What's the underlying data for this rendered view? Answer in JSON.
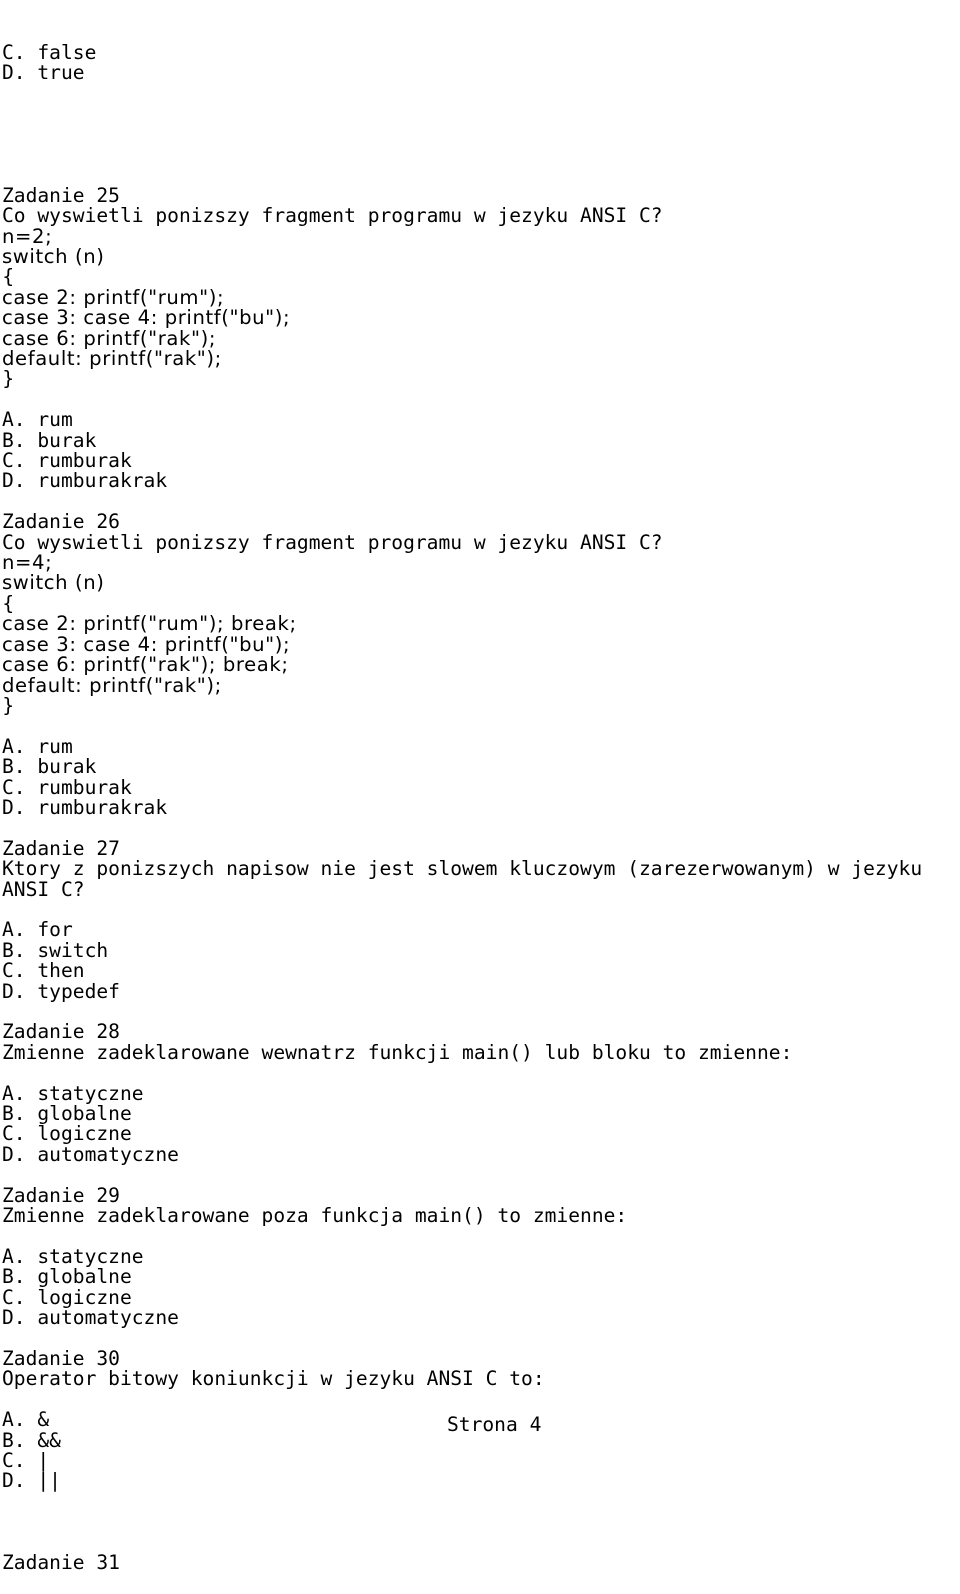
{
  "leading_options": [
    {
      "letter": "C.",
      "text": "false"
    },
    {
      "letter": "D.",
      "text": "true"
    }
  ],
  "tasks": [
    {
      "title": "Zadanie 25",
      "question": [
        "Co wyswietli ponizszy fragment programu w jezyku ANSI C?"
      ],
      "code": [
        "n=2;",
        "switch (n)",
        "{",
        "case 2: printf(\"rum\");",
        "case 3: case 4: printf(\"bu\");",
        "case 6: printf(\"rak\");",
        "default: printf(\"rak\");",
        "}"
      ],
      "options": [
        {
          "letter": "A.",
          "text": "rum"
        },
        {
          "letter": "B.",
          "text": "burak"
        },
        {
          "letter": "C.",
          "text": "rumburak"
        },
        {
          "letter": "D.",
          "text": "rumburakrak"
        }
      ]
    },
    {
      "title": "Zadanie 26",
      "question": [
        "Co wyswietli ponizszy fragment programu w jezyku ANSI C?"
      ],
      "code": [
        "n=4;",
        "switch (n)",
        "{",
        "case 2: printf(\"rum\"); break;",
        "case 3: case 4: printf(\"bu\");",
        "case 6: printf(\"rak\"); break;",
        "default: printf(\"rak\");",
        "}"
      ],
      "options": [
        {
          "letter": "A.",
          "text": "rum"
        },
        {
          "letter": "B.",
          "text": "burak"
        },
        {
          "letter": "C.",
          "text": "rumburak"
        },
        {
          "letter": "D.",
          "text": "rumburakrak"
        }
      ]
    },
    {
      "title": "Zadanie 27",
      "question": [
        "Ktory z ponizszych napisow nie jest slowem kluczowym (zarezerwowanym) w jezyku",
        "ANSI C?"
      ],
      "code": [],
      "options": [
        {
          "letter": "A.",
          "text": "for"
        },
        {
          "letter": "B.",
          "text": "switch"
        },
        {
          "letter": "C.",
          "text": "then"
        },
        {
          "letter": "D.",
          "text": "typedef"
        }
      ]
    },
    {
      "title": "Zadanie 28",
      "question": [
        "Zmienne zadeklarowane wewnatrz funkcji main() lub bloku to zmienne:"
      ],
      "code": [],
      "options": [
        {
          "letter": "A.",
          "text": "statyczne"
        },
        {
          "letter": "B.",
          "text": "globalne"
        },
        {
          "letter": "C.",
          "text": "logiczne"
        },
        {
          "letter": "D.",
          "text": "automatyczne"
        }
      ]
    },
    {
      "title": "Zadanie 29",
      "question": [
        "Zmienne zadeklarowane poza funkcja main() to zmienne:"
      ],
      "code": [],
      "options": [
        {
          "letter": "A.",
          "text": "statyczne"
        },
        {
          "letter": "B.",
          "text": "globalne"
        },
        {
          "letter": "C.",
          "text": "logiczne"
        },
        {
          "letter": "D.",
          "text": "automatyczne"
        }
      ]
    },
    {
      "title": "Zadanie 30",
      "question": [
        "Operator bitowy koniunkcji w jezyku ANSI C to:"
      ],
      "code": [],
      "options": [
        {
          "letter": "A.",
          "text": "&"
        },
        {
          "letter": "B.",
          "text": "&&"
        },
        {
          "letter": "C.",
          "text": "|"
        },
        {
          "letter": "D.",
          "text": "||"
        }
      ]
    }
  ],
  "trailing_title": "Zadanie 31",
  "footer": {
    "page_label": "Strona 4"
  }
}
